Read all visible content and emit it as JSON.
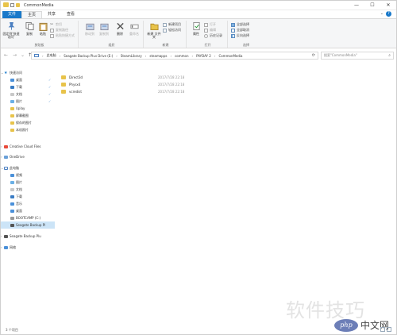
{
  "window": {
    "title": "CommonMedia",
    "controls": [
      "—",
      "☐",
      "✕"
    ]
  },
  "tabs": {
    "file": "文件",
    "home": "主页",
    "share": "共享",
    "view": "查看"
  },
  "ribbon": {
    "clipboard": {
      "label": "剪贴板",
      "pin": "固定到'快速访问'",
      "copy": "复制",
      "paste": "粘贴",
      "cut": "剪切",
      "copy_path": "复制路径",
      "paste_shortcut": "粘贴快捷方式"
    },
    "organize": {
      "label": "组织",
      "move_to": "移动到",
      "copy_to": "复制到",
      "delete": "删除",
      "rename": "重命名"
    },
    "new": {
      "label": "新建",
      "new_folder": "新建\n文件夹",
      "new_item": "新建项目",
      "easy_access": "轻松访问"
    },
    "open": {
      "label": "打开",
      "properties": "属性",
      "open": "打开",
      "edit": "编辑",
      "history": "历史记录"
    },
    "select": {
      "label": "选择",
      "select_all": "全部选择",
      "select_none": "全部取消",
      "invert": "反向选择"
    }
  },
  "address": {
    "crumbs": [
      "此电脑",
      "Seagate Backup Plus Drive (E:)",
      "SteamLibrary",
      "steamapps",
      "common",
      "PAYDAY 2",
      "CommonMedia"
    ],
    "search_placeholder": "搜索\"CommonMedia\""
  },
  "nav": {
    "quick_access": "快速访问",
    "desktop": "桌面",
    "downloads": "下载",
    "documents": "文档",
    "pictures": "图片",
    "uplay": "Uplay",
    "screenshots": "屏幕截图",
    "recordings": "保存的图片",
    "local_pics": "本机照片",
    "creative_cloud": "Creative Cloud Files",
    "onedrive": "OneDrive",
    "this_pc": "此电脑",
    "videos": "视频",
    "pics2": "图片",
    "docs2": "文档",
    "downloads2": "下载",
    "music": "音乐",
    "desktop2": "桌面",
    "bootcamp": "BOOTCAMP (C:)",
    "seagate_e": "Seagate Backup Pl",
    "seagate2": "Seagate Backup Plu",
    "network": "网络"
  },
  "files": [
    {
      "name": "Direct3d",
      "date": "2017/7/28 22:18"
    },
    {
      "name": "Physx4",
      "date": "2017/7/28 22:18"
    },
    {
      "name": "vcredist",
      "date": "2017/7/28 22:18"
    }
  ],
  "status": {
    "count": "3 个项目"
  },
  "watermark": {
    "text": "软件技巧",
    "php": "php",
    "cn": "中文网"
  },
  "colors": {
    "accent": "#1979ca",
    "folder": "#e8c34a",
    "selected": "#cce4f7"
  }
}
